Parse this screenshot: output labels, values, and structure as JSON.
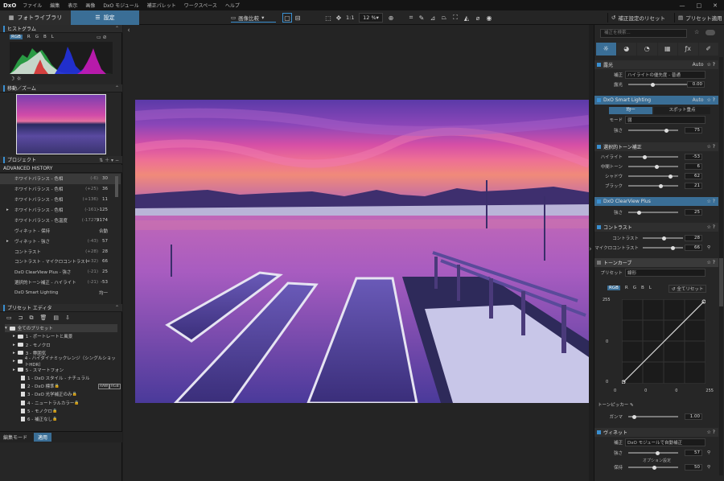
{
  "menubar": {
    "logo": "DxO",
    "items": [
      "ファイル",
      "編集",
      "表示",
      "画像",
      "DxO モジュール",
      "補正パレット",
      "ワークスペース",
      "ヘルプ"
    ],
    "window_buttons": [
      "—",
      "□",
      "✕"
    ]
  },
  "tabs": {
    "library": "フォトライブラリ",
    "customize": "設定"
  },
  "toolbar": {
    "compare": "画像比較",
    "ratio": "1:1",
    "zoom": "12 %",
    "reset": "補正設定のリセット",
    "apply_preset": "プリセット適用"
  },
  "histogram": {
    "title": "ヒストグラム",
    "channels": [
      "RGB",
      "R",
      "G",
      "B",
      "L"
    ]
  },
  "navigator": {
    "title": "移動／ズーム"
  },
  "project": {
    "title": "プロジェクト"
  },
  "history": {
    "title": "ADVANCED HISTORY",
    "rows": [
      {
        "label": "ホワイトバランス - 色相",
        "delta": "(-6)",
        "value": "30"
      },
      {
        "label": "ホワイトバランス - 色相",
        "delta": "(+25)",
        "value": "36"
      },
      {
        "label": "ホワイトバランス - 色相",
        "delta": "(+136)",
        "value": "11"
      },
      {
        "label": "ホワイトバランス - 色相",
        "delta": "(-161)",
        "value": "-125"
      },
      {
        "label": "ホワイトバランス - 色温度",
        "delta": "(-1727)",
        "value": "9174"
      },
      {
        "label": "ヴィネット - 保持",
        "delta": "",
        "value": "合動"
      },
      {
        "label": "ヴィネット - 強さ",
        "delta": "(-43)",
        "value": "57"
      },
      {
        "label": "コントラスト",
        "delta": "(+28)",
        "value": "28"
      },
      {
        "label": "コントラスト - マイクロコントラスト",
        "delta": "(+32)",
        "value": "66"
      },
      {
        "label": "DxO ClearView Plus - 強さ",
        "delta": "(-21)",
        "value": "25"
      },
      {
        "label": "選択的トーン補正 - ハイライト",
        "delta": "(-21)",
        "value": "-53"
      },
      {
        "label": "DxO Smart Lighting",
        "delta": "",
        "value": "均一"
      }
    ]
  },
  "preset_editor": {
    "title": "プリセット エディタ",
    "tree": [
      {
        "label": "全てのプリセット",
        "type": "folder",
        "level": 0
      },
      {
        "label": "1 - ポートレートと風景",
        "type": "folder",
        "level": 1
      },
      {
        "label": "2 - モノクロ",
        "type": "folder",
        "level": 1
      },
      {
        "label": "3 - 雰囲気",
        "type": "folder",
        "level": 1
      },
      {
        "label": "4 - ハイダイナミックレンジ（シングルショットHDR）",
        "type": "folder",
        "level": 1
      },
      {
        "label": "5 - スマートフォン",
        "type": "folder",
        "level": 1
      },
      {
        "label": "1 - DxO スタイル - ナチュラル",
        "type": "doc",
        "level": 2
      },
      {
        "label": "2 - DxO 標準",
        "type": "doc",
        "level": 2
      },
      {
        "label": "3 - DxO 光学補正のみ",
        "type": "doc",
        "level": 2
      },
      {
        "label": "4 - ニュートラルカラー",
        "type": "doc",
        "level": 2
      },
      {
        "label": "5 - モノクロ",
        "type": "doc",
        "level": 2
      },
      {
        "label": "6 - 補正なし",
        "type": "doc",
        "level": 2
      }
    ],
    "badges": [
      "RAW",
      "RGB"
    ]
  },
  "bottom": {
    "edit_mode": "編集モード",
    "apply": "適用"
  },
  "right": {
    "search_placeholder": "補正を検索...",
    "exposure": {
      "title": "露光",
      "auto": "Auto",
      "mode_label": "補正",
      "mode_value": "ハイライトの優先度 - 普通",
      "slider_label": "露光",
      "value": "0.00"
    },
    "smart_lighting": {
      "title": "DxO Smart Lighting",
      "auto": "Auto",
      "btn1": "均一",
      "btn2": "スポット重点",
      "mode_label": "モード",
      "mode_value": "弱",
      "slider_label": "強さ",
      "value": "75"
    },
    "tone": {
      "title": "選択的トーン補正",
      "rows": [
        {
          "label": "ハイライト",
          "value": "-53"
        },
        {
          "label": "中間トーン",
          "value": "6"
        },
        {
          "label": "シャドウ",
          "value": "62"
        },
        {
          "label": "ブラック",
          "value": "21"
        }
      ]
    },
    "clearview": {
      "title": "DxO ClearView Plus",
      "label": "強さ",
      "value": "25"
    },
    "contrast": {
      "title": "コントラスト",
      "rows": [
        {
          "label": "コントラスト",
          "value": "28"
        },
        {
          "label": "マイクロコントラスト",
          "value": "66"
        }
      ]
    },
    "tonecurve": {
      "title": "トーンカーブ",
      "preset_label": "プリセット",
      "preset_value": "線形",
      "channels": [
        "RGB",
        "R",
        "G",
        "B",
        "L"
      ],
      "reset": "全てリセット",
      "in_max": "255",
      "in_mid": "0",
      "in_min": "0",
      "out_labels": [
        "0",
        "0",
        "0",
        "255"
      ],
      "picker": "トーンピッカー",
      "gamma_label": "ガンマ",
      "gamma_value": "1.00"
    },
    "vignette": {
      "title": "ヴィネット",
      "mode_label": "補正",
      "mode_value": "DxO モジュールで自動補正",
      "strength_label": "強さ",
      "strength_value": "57",
      "options": "オプション設定",
      "keep_label": "保持",
      "keep_value": "50"
    }
  }
}
